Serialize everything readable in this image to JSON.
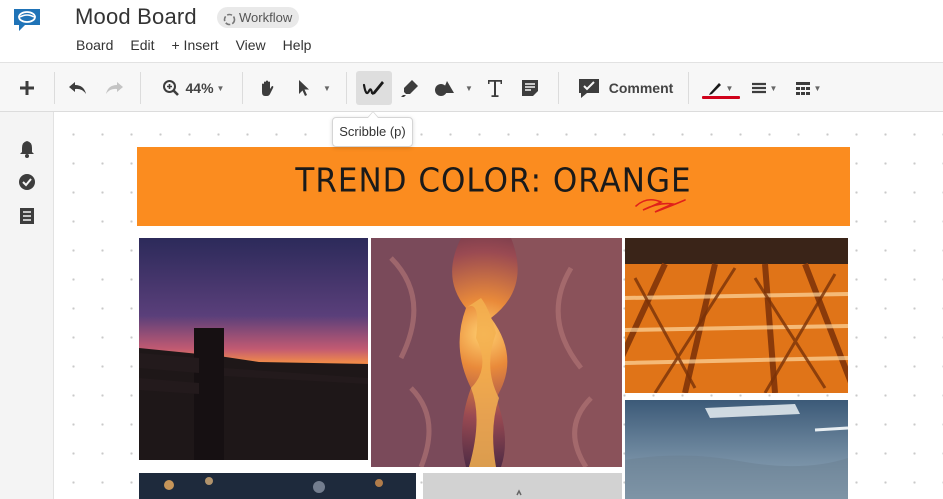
{
  "app": {
    "title": "Mood Board",
    "workflow_label": "Workflow"
  },
  "menu": [
    "Board",
    "Edit",
    "+ Insert",
    "View",
    "Help"
  ],
  "toolbar": {
    "zoom": "44%",
    "comment_label": "Comment",
    "pen_color": "#d0021b"
  },
  "tooltip": "Scribble (p)",
  "board": {
    "banner_text": "TREND COLOR: ORANGE",
    "banner_color": "#fb8c1f"
  },
  "icons": [
    "brand-logo-icon",
    "workflow-icon",
    "plus-icon",
    "undo-icon",
    "redo-icon",
    "zoom-icon",
    "hand-icon",
    "pointer-icon",
    "scribble-icon",
    "highlighter-icon",
    "shapes-icon",
    "text-icon",
    "note-icon",
    "comment-icon",
    "pen-color-icon",
    "line-style-icon",
    "grid-icon",
    "bell-icon",
    "check-circle-icon",
    "list-icon"
  ],
  "photos": [
    "sunset-fence-photo",
    "canyon-photo",
    "orange-tiles-shadow-photo",
    "sky-window-photo",
    "city-lights-photo",
    "gray-photo"
  ]
}
